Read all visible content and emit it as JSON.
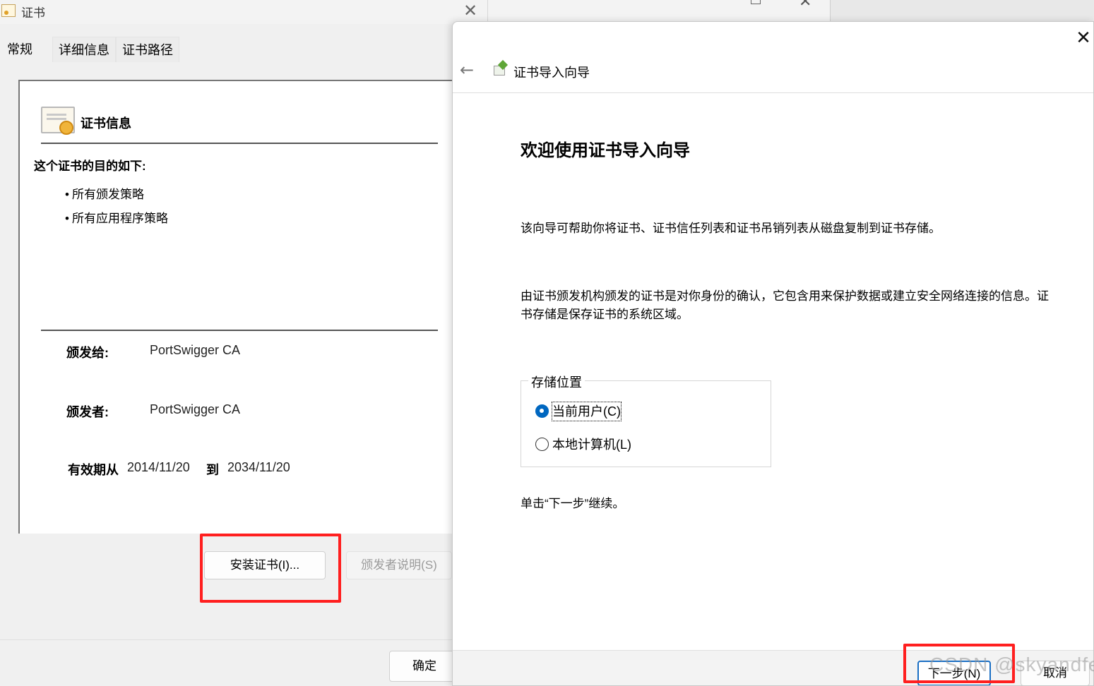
{
  "cert_dialog": {
    "title": "证书",
    "tabs": [
      {
        "label": "常规",
        "active": true
      },
      {
        "label": "详细信息",
        "active": false
      },
      {
        "label": "证书路径",
        "active": false
      }
    ],
    "info_heading": "证书信息",
    "purpose_heading": "这个证书的目的如下:",
    "purposes": [
      "所有颁发策略",
      "所有应用程序策略"
    ],
    "issued_to_label": "颁发给:",
    "issued_to_value": "PortSwigger CA",
    "issued_by_label": "颁发者:",
    "issued_by_value": "PortSwigger CA",
    "validity_label": "有效期从",
    "validity_from": "2014/11/20",
    "validity_to_label": "到",
    "validity_to": "2034/11/20",
    "install_button": "安装证书(I)...",
    "issuer_statement_button": "颁发者说明(S)",
    "ok_button": "确定"
  },
  "wizard": {
    "header_title": "证书导入向导",
    "heading": "欢迎使用证书导入向导",
    "desc1": "该向导可帮助你将证书、证书信任列表和证书吊销列表从磁盘复制到证书存储。",
    "desc2": "由证书颁发机构颁发的证书是对你身份的确认，它包含用来保护数据或建立安全网络连接的信息。证书存储是保存证书的系统区域。",
    "store_location_label": "存储位置",
    "store_options": [
      {
        "label": "当前用户(C)",
        "checked": true
      },
      {
        "label": "本地计算机(L)",
        "checked": false
      }
    ],
    "continue_text": "单击“下一步”继续。",
    "next_button": "下一步(N)",
    "cancel_button": "取消"
  },
  "watermark": "CSDN @skyandfeiyu",
  "colors": {
    "highlight": "#ff1f1f",
    "accent": "#0067c0"
  }
}
